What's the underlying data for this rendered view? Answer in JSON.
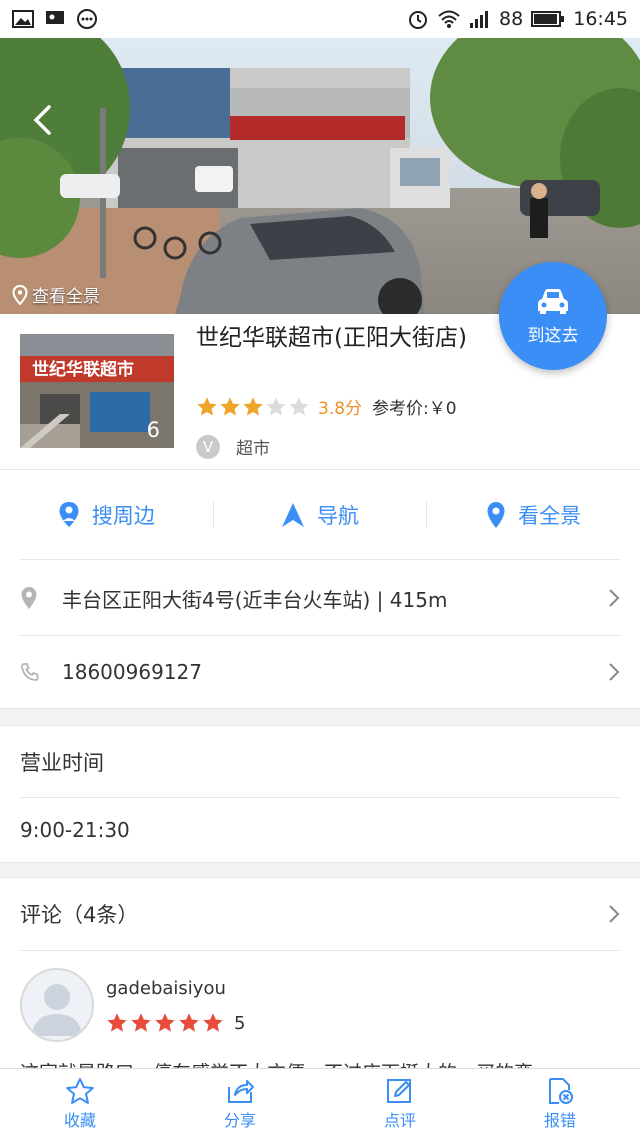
{
  "status_bar": {
    "battery": "88",
    "time": "16:45"
  },
  "hero": {
    "pano_label": "查看全景",
    "goto_label": "到这去"
  },
  "poi": {
    "name": "世纪华联超市(正阳大街店)",
    "photo_count": "6",
    "rating": 3.8,
    "score_text": "3.8分",
    "price_text": "参考价:￥0",
    "category_badge": "V",
    "category": "超市",
    "thumb_sign": "世纪华联超市"
  },
  "actions": [
    {
      "label": "搜周边",
      "icon": "location-pin-person-icon"
    },
    {
      "label": "导航",
      "icon": "navigation-arrow-icon"
    },
    {
      "label": "看全景",
      "icon": "panorama-pin-icon"
    }
  ],
  "address": {
    "text": "丰台区正阳大街4号(近丰台火车站) | 415m"
  },
  "phone": {
    "text": "18600969127"
  },
  "hours": {
    "title": "营业时间",
    "value": "9:00-21:30"
  },
  "comments": {
    "header": "评论（4条）",
    "items": [
      {
        "user": "gadebaisiyou",
        "rating": 5,
        "score": "5",
        "text": "这家就是路口，停车感觉不太方便，不过店面挺大的，买的蛮"
      }
    ]
  },
  "bottom_bar": [
    {
      "label": "收藏",
      "icon": "star-outline-icon"
    },
    {
      "label": "分享",
      "icon": "share-icon"
    },
    {
      "label": "点评",
      "icon": "edit-review-icon"
    },
    {
      "label": "报错",
      "icon": "report-error-icon"
    }
  ],
  "colors": {
    "accent": "#3a8ef5",
    "star": "#f0a52a",
    "red_star": "#e84a3c"
  }
}
